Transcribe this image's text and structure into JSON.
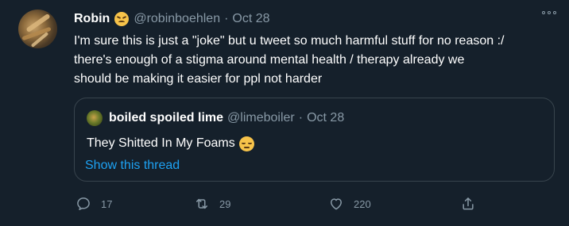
{
  "tweet": {
    "author": {
      "display_name": "Robin",
      "handle": "@robinboehlen",
      "date": "Oct 28",
      "emoji_icon": "confounded-face-emoji"
    },
    "separator": "·",
    "text_lines": [
      "I'm sure this is just a \"joke\" but u tweet so much harmful stuff for no reason :/",
      "there's enough of a stigma around mental health / therapy already we",
      "should be making it easier for ppl not harder"
    ],
    "quoted": {
      "display_name": "boiled spoiled lime",
      "handle": "@limeboiler",
      "date": "Oct 28",
      "text": "They Shitted In My Foams",
      "emoji_icon": "pensive-face-emoji",
      "show_thread_label": "Show this thread"
    },
    "actions": {
      "reply_count": "17",
      "retweet_count": "29",
      "like_count": "220"
    }
  },
  "colors": {
    "background": "#15202b",
    "secondary_text": "#8899a6",
    "link": "#1da1f2",
    "border": "#38444d"
  }
}
